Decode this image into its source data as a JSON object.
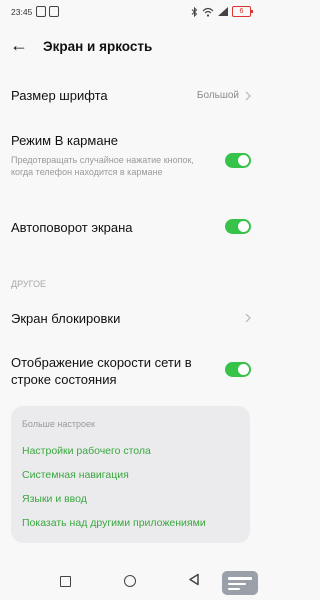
{
  "status_bar": {
    "time": "23:45",
    "battery": "6"
  },
  "header": {
    "title": "Экран и яркость"
  },
  "rows": {
    "font_size": {
      "label": "Размер шрифта",
      "value": "Большой"
    },
    "pocket_mode": {
      "label": "Режим В кармане",
      "description": "Предотвращать случайное нажатие кнопок, когда телефон находится в кармане",
      "enabled": true
    },
    "auto_rotate": {
      "label": "Автоповорот экрана",
      "enabled": true
    },
    "lock_screen": {
      "label": "Экран блокировки"
    },
    "net_speed": {
      "label": "Отображение скорости сети в строке состояния",
      "enabled": true
    }
  },
  "section_other": "ДРУГОЕ",
  "more_settings": {
    "header": "Больше настроек",
    "links": [
      "Настройки рабочего стола",
      "Системная навигация",
      "Языки и ввод",
      "Показать над другими приложениями"
    ]
  },
  "colors": {
    "accent": "#37c24a",
    "link": "#3aa83e"
  }
}
